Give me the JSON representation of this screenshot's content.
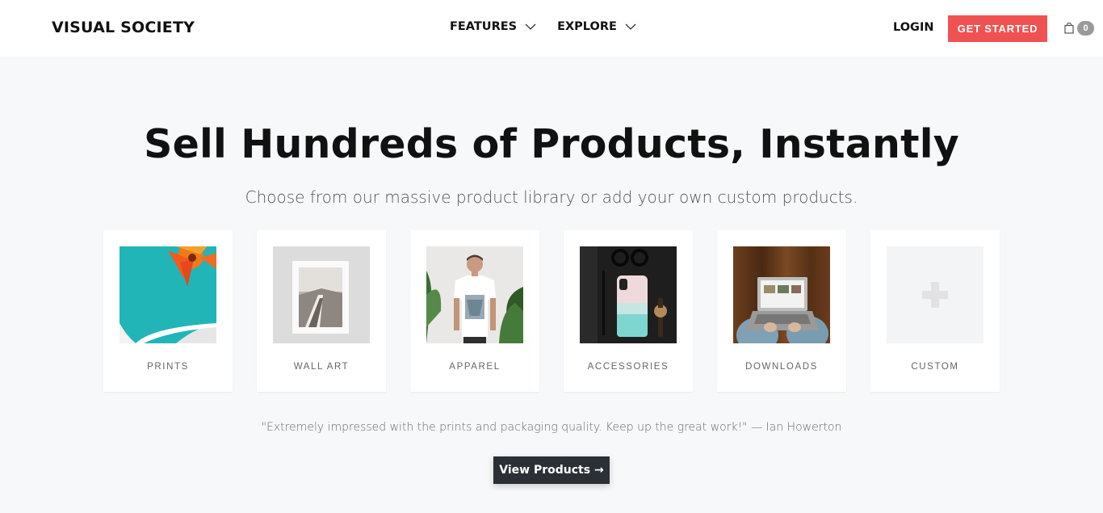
{
  "nav": {
    "brand": "VISUAL SOCIETY",
    "menu": [
      {
        "label": "FEATURES"
      },
      {
        "label": "EXPLORE"
      }
    ],
    "login_label": "LOGIN",
    "cta_label": "GET STARTED",
    "cart_count": "0"
  },
  "hero": {
    "title": "Sell Hundreds of Products, Instantly",
    "subtitle": "Choose from our massive product library or add your own custom products."
  },
  "products": [
    {
      "label": "PRINTS",
      "icon": "prints-image"
    },
    {
      "label": "WALL ART",
      "icon": "wall-art-image"
    },
    {
      "label": "APPAREL",
      "icon": "apparel-image"
    },
    {
      "label": "ACCESSORIES",
      "icon": "accessories-image"
    },
    {
      "label": "DOWNLOADS",
      "icon": "downloads-image"
    },
    {
      "label": "CUSTOM",
      "icon": "plus-icon"
    }
  ],
  "testimonial": "\"Extremely impressed with the prints and packaging quality. Keep up the great work!\" — Ian Howerton",
  "view_button": "View Products →",
  "colors": {
    "cta": "#f05252",
    "dark_button": "#2b3036",
    "background": "#f7f8fa"
  }
}
